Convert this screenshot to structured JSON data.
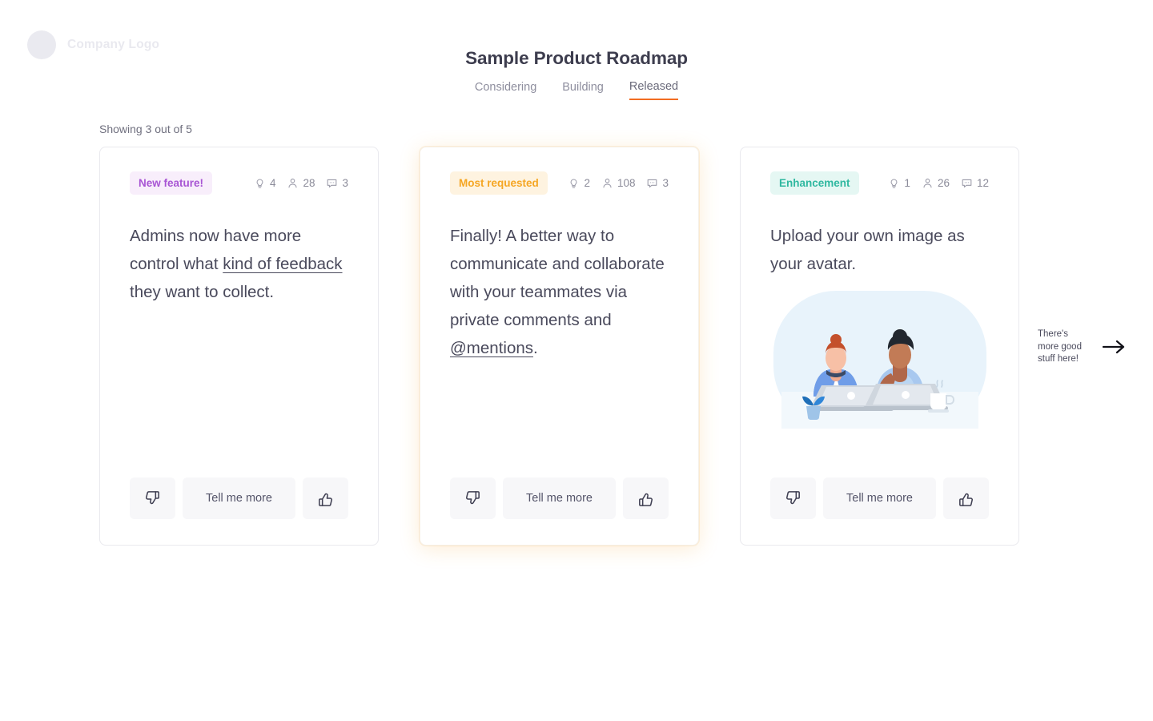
{
  "brand": {
    "logo_text": "Company Logo",
    "logo_icon": "circle-placeholder-icon",
    "accent_color": "#f26c21"
  },
  "header": {
    "title": "Sample Product Roadmap",
    "tabs": [
      {
        "label": "Considering",
        "active": false
      },
      {
        "label": "Building",
        "active": false
      },
      {
        "label": "Released",
        "active": true
      }
    ]
  },
  "list": {
    "showing_text": "Showing 3 out of 5"
  },
  "cards": [
    {
      "badge": {
        "label": "New feature!",
        "color": "#a855d4",
        "bg": "#f8eefb"
      },
      "metrics": {
        "ideas_icon": "lightbulb-icon",
        "ideas": "4",
        "voters_icon": "person-icon",
        "voters": "28",
        "comments_icon": "comment-icon",
        "comments": "3"
      },
      "text_before": "Admins now have more control what ",
      "link_text": "kind of feedback",
      "text_after": " they want to collect.",
      "has_illustration": false,
      "actions": {
        "dislike_icon": "thumbs-down-icon",
        "more_label": "Tell me more",
        "like_icon": "thumbs-up-icon"
      },
      "featured": false
    },
    {
      "badge": {
        "label": "Most requested",
        "color": "#f5a623",
        "bg": "#fef3e0"
      },
      "metrics": {
        "ideas_icon": "lightbulb-icon",
        "ideas": "2",
        "voters_icon": "person-icon",
        "voters": "108",
        "comments_icon": "comment-icon",
        "comments": "3"
      },
      "text_before": "Finally!  A better way to communicate and collaborate with your teammates via private comments and ",
      "link_text": "@mentions",
      "text_after": ".",
      "has_illustration": false,
      "actions": {
        "dislike_icon": "thumbs-down-icon",
        "more_label": "Tell me more",
        "like_icon": "thumbs-up-icon"
      },
      "featured": true
    },
    {
      "badge": {
        "label": "Enhancement",
        "color": "#2fb8a0",
        "bg": "#e5f7f3"
      },
      "metrics": {
        "ideas_icon": "lightbulb-icon",
        "ideas": "1",
        "voters_icon": "person-icon",
        "voters": "26",
        "comments_icon": "comment-icon",
        "comments": "12"
      },
      "text_before": "Upload your own image as your avatar.",
      "link_text": "",
      "text_after": "",
      "has_illustration": true,
      "illustration_name": "two-people-at-laptops-illustration",
      "actions": {
        "dislike_icon": "thumbs-down-icon",
        "more_label": "Tell me more",
        "like_icon": "thumbs-up-icon"
      },
      "featured": false
    }
  ],
  "annotation": {
    "text": "There's more good stuff here!",
    "arrow_icon": "arrow-right-icon"
  }
}
